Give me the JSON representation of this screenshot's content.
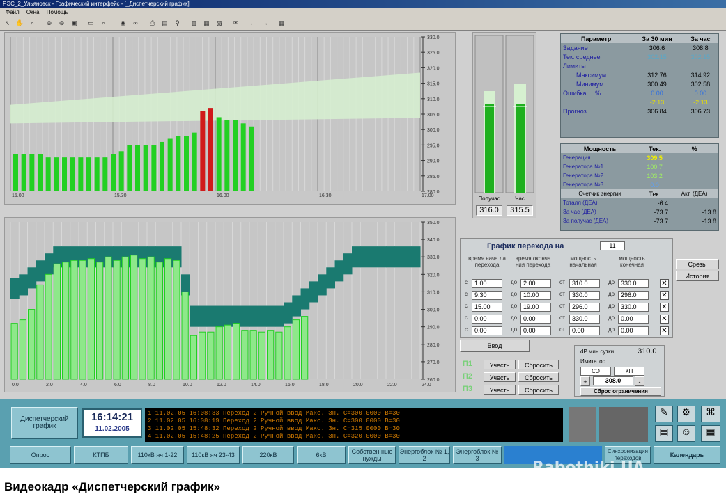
{
  "window": {
    "title": "РЭС_2_Ульяновск - Графический интерфейс - [_Диспетчерский график]"
  },
  "menu": [
    "Файл",
    "Окна",
    "Помощь"
  ],
  "top_chart": {
    "x_ticks": [
      "15.00",
      "15.30",
      "16.00",
      "16.30",
      "17.00"
    ],
    "y_ticks": [
      "330.0",
      "325.0",
      "320.0",
      "315.0",
      "310.0",
      "305.0",
      "300.0",
      "295.0",
      "290.0",
      "285.0",
      "280.0"
    ],
    "band_lower": [
      302,
      303.8
    ],
    "band_upper": [
      308,
      318.4
    ],
    "bars": [
      292,
      292,
      292,
      292,
      291,
      291,
      291,
      291,
      291,
      291,
      291,
      291,
      292,
      293,
      295,
      295,
      295,
      295,
      296,
      297,
      298,
      298,
      299,
      306,
      307,
      304,
      303,
      303,
      302,
      301
    ],
    "red_bars": [
      23,
      24
    ],
    "colors": {
      "bar": "#22d022",
      "red": "#d01a1a",
      "band": "#d6f0d0"
    }
  },
  "gauges": {
    "half_hour": {
      "label": "Получас",
      "value": "316.0"
    },
    "hour": {
      "label": "Час",
      "value": "315.5"
    }
  },
  "params_table": {
    "headers": [
      "Параметр",
      "За 30 мин",
      "За час"
    ],
    "rows": [
      {
        "label": "Задание",
        "v1": "306.6",
        "v2": "308.8"
      },
      {
        "label": "Тек. среднее",
        "v1": "302.15",
        "v2": "302.15"
      },
      {
        "label": "Лимиты",
        "v1": "",
        "v2": ""
      },
      {
        "label": "Максимум",
        "v1": "312.76",
        "v2": "314.92"
      },
      {
        "label": "Минимум",
        "v1": "300.49",
        "v2": "302.58"
      },
      {
        "label": "Ошибка",
        "unit": "%",
        "v1": "0.00",
        "v2": "0.00"
      },
      {
        "label": "",
        "v1": "-2.13",
        "v2": "-2.13"
      },
      {
        "label": "Прогноз",
        "v1": "306.84",
        "v2": "306.73"
      }
    ]
  },
  "power_table": {
    "headers": [
      "Мощность",
      "Тек.",
      "%"
    ],
    "rows": [
      {
        "label": "Генерация",
        "v1": "309.5",
        "v2": ""
      },
      {
        "label": "Генератора №1",
        "v1": "100.7",
        "v2": ""
      },
      {
        "label": "Генератора №2",
        "v1": "103.2",
        "v2": ""
      },
      {
        "label": "Генератора №3",
        "v1": "0.0",
        "v2": ""
      }
    ],
    "energy_headers": [
      "Счетчик энергии",
      "Тек.",
      "Акт. (ДЕА)"
    ],
    "energy_rows": [
      {
        "label": "Тоталл (ДЕА)",
        "v1": "-6.4",
        "v2": ""
      },
      {
        "label": "За час (ДЕА)",
        "v1": "-73.7",
        "v2": "-13.8"
      },
      {
        "label": "За получас (ДЕА)",
        "v1": "-73.7",
        "v2": "-13.8"
      }
    ]
  },
  "bottom_chart": {
    "x_ticks": [
      "0.0",
      "2.0",
      "4.0",
      "6.0",
      "8.0",
      "10.0",
      "12.0",
      "14.0",
      "16.0",
      "18.0",
      "20.0",
      "22.0",
      "24.0"
    ],
    "y_ticks": [
      "350.0",
      "340.0",
      "330.0",
      "320.0",
      "310.0",
      "300.0",
      "290.0",
      "280.0",
      "270.0",
      "260.0"
    ],
    "band_center": [
      312,
      314,
      318,
      322,
      326,
      330,
      330,
      330,
      330,
      330,
      330,
      330,
      330,
      330,
      330,
      330,
      330,
      330,
      330,
      330,
      314,
      296,
      296,
      296,
      296,
      296,
      296,
      296,
      296,
      296,
      296,
      296,
      298,
      302,
      306,
      310,
      314,
      318,
      322,
      326,
      330,
      330,
      330,
      330,
      330,
      330,
      330,
      330
    ],
    "bars": [
      292,
      294,
      300,
      314,
      320,
      326,
      327,
      328,
      328,
      329,
      327,
      330,
      328,
      330,
      331,
      329,
      330,
      327,
      329,
      328,
      310,
      285,
      287,
      287,
      290,
      291,
      292,
      288,
      288,
      287,
      288,
      287,
      290,
      294,
      296
    ],
    "colors": {
      "band": "#1a7a70",
      "bar": "#8ee88a",
      "bar_edge": "#22d022"
    }
  },
  "transition": {
    "title": "График перехода на",
    "hour": "11",
    "col_headers": [
      "время нача ла перехода",
      "время оконча ния перехода",
      "мощность начальная",
      "мощность конечная"
    ],
    "rows": [
      [
        "1.00",
        "2.00",
        "310.0",
        "330.0"
      ],
      [
        "9.30",
        "10.00",
        "330.0",
        "296.0"
      ],
      [
        "15.00",
        "19.00",
        "296.0",
        "330.0"
      ],
      [
        "0.00",
        "0.00",
        "330.0",
        "0.00"
      ],
      [
        "0.00",
        "0.00",
        "0.00",
        "0.00"
      ]
    ],
    "from_label": "с",
    "to_label": "до",
    "ot_label": "от",
    "input_button": "Ввод"
  },
  "side_buttons": [
    "Срезы",
    "История"
  ],
  "accounting": [
    {
      "tag": "П1",
      "btn1": "Учесть",
      "btn2": "Сбросить"
    },
    {
      "tag": "П2",
      "btn1": "Учесть",
      "btn2": "Сбросить"
    },
    {
      "tag": "П3",
      "btn1": "Учесть",
      "btn2": "Сбросить"
    }
  ],
  "corrector": {
    "label": "dP мин сутки",
    "value": "310.0",
    "sub": "Имитатор",
    "c1": "СО",
    "c2": "КП",
    "plus": "+",
    "value2": "308.0",
    "minus": "-",
    "reset": "Сброс ограничения"
  },
  "bottom_bar": {
    "dispatch": "Диспетчерский график",
    "time": "16:14:21",
    "date": "11.02.2005",
    "log": [
      "1  11.02.05 16:08:33 Переход 2   Ручной ввод Макс. Зн. С=300.0000 В=30",
      "2  11.02.05 16:08:19 Переход 2   Ручной ввод Макс. Зн. С=300.0000 В=30",
      "3  11.02.05 15:48:32 Переход 2   Ручной ввод Макс. Зн. С=315.0000 В=30",
      "4  11.02.05 15:48:25 Переход 2   Ручной ввод Макс. Зн. С=320.0000 В=30"
    ],
    "nav": [
      "Опрос",
      "КТПБ",
      "110кВ яч 1-22",
      "110кВ яч 23-43",
      "220кВ",
      "6кВ",
      "Собствен ные нужды",
      "Энергоблок № 1, 2",
      "Энергоблок № 3"
    ],
    "right_buttons": [
      "Синхронизация переходов",
      "Календарь"
    ]
  },
  "watermark": "Rabothiki.UA",
  "caption": "Видеокадр «Диспетчерский график»"
}
